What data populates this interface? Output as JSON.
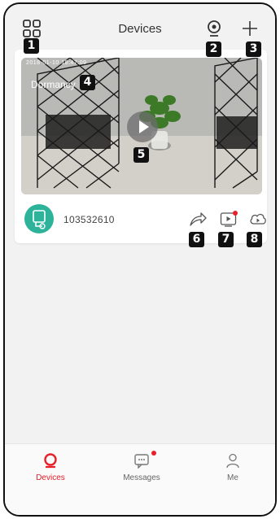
{
  "header": {
    "title": "Devices"
  },
  "badges": [
    "1",
    "2",
    "3",
    "4",
    "5",
    "6",
    "7",
    "8"
  ],
  "device": {
    "timestamp": "2018-01-10 18:47:09",
    "status": "Dormancy",
    "id": "103532610"
  },
  "tabs": [
    {
      "label": "Devices",
      "icon": "devices-icon",
      "active": true
    },
    {
      "label": "Messages",
      "icon": "messages-icon",
      "notification_dot": true
    },
    {
      "label": "Me",
      "icon": "person-icon"
    }
  ],
  "colors": {
    "accent": "#e8202a",
    "avatar": "#2cb39a"
  }
}
